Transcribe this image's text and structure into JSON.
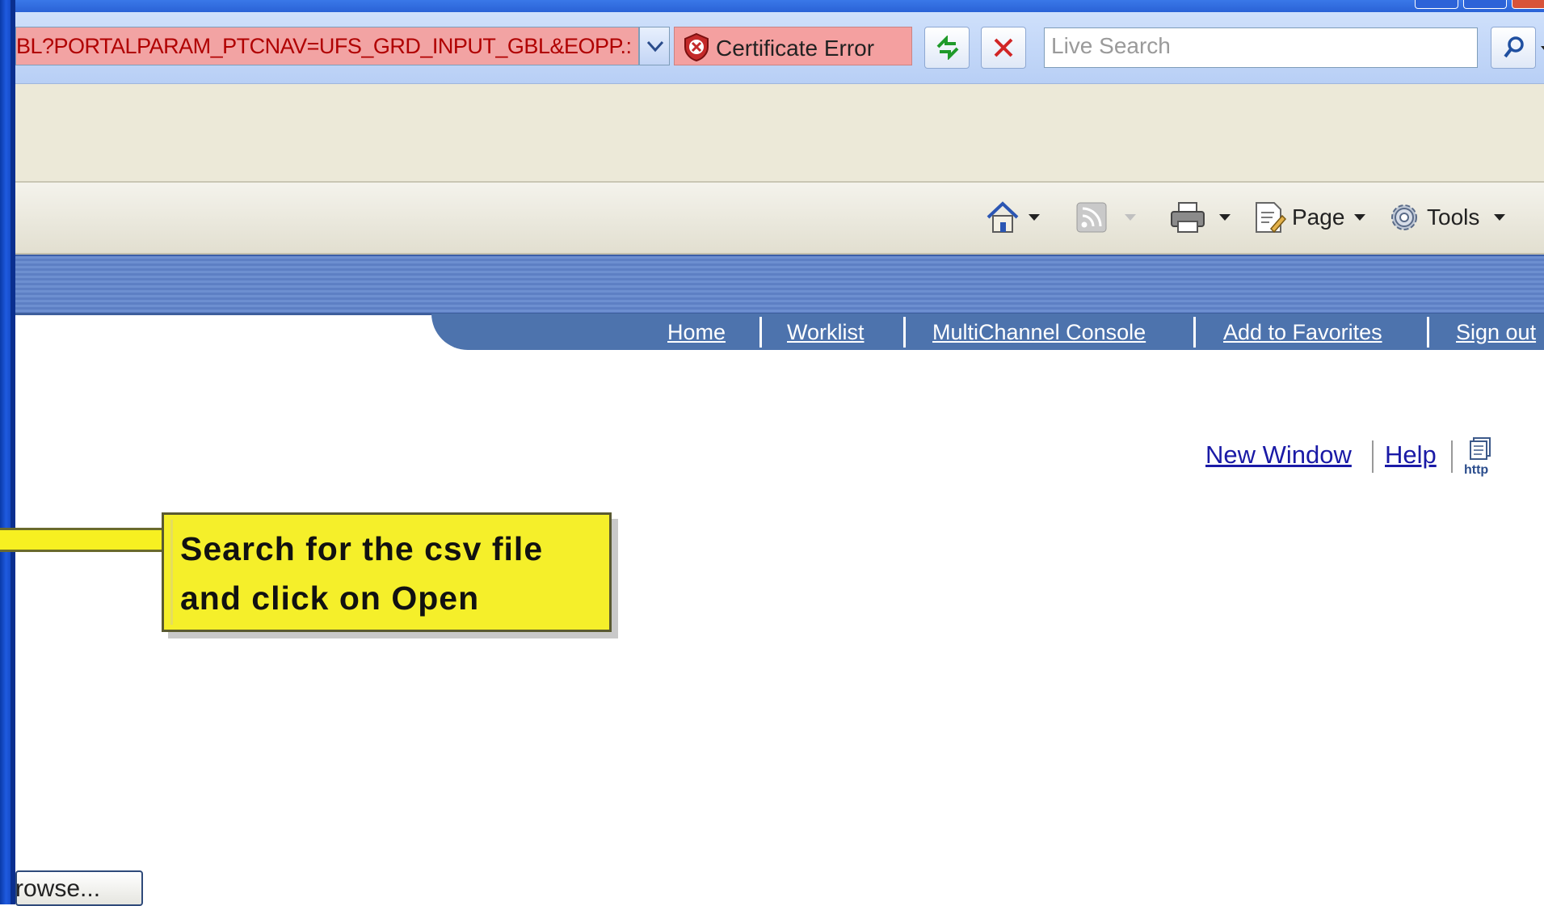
{
  "address_bar": {
    "url": "BL?PORTALPARAM_PTCNAV=UFS_GRD_INPUT_GBL&EOPP.:",
    "certificate_error_label": "Certificate Error"
  },
  "search": {
    "placeholder": "Live Search"
  },
  "command_bar": {
    "page_label": "Page",
    "tools_label": "Tools"
  },
  "portal_nav": {
    "links": [
      "Home",
      "Worklist",
      "MultiChannel Console",
      "Add to Favorites",
      "Sign out"
    ]
  },
  "utility_links": {
    "new_window": "New Window",
    "help": "Help",
    "http_icon_text": "http"
  },
  "callout": {
    "line1": "Search for the csv file",
    "line2": "and click on Open"
  },
  "browse_button": {
    "label": "rowse..."
  },
  "colors": {
    "address_error_bg": "#f2a3a3",
    "nav_bar": "#4d73ad",
    "callout_yellow": "#f5ef2a",
    "link_blue": "#1a1aa6"
  }
}
